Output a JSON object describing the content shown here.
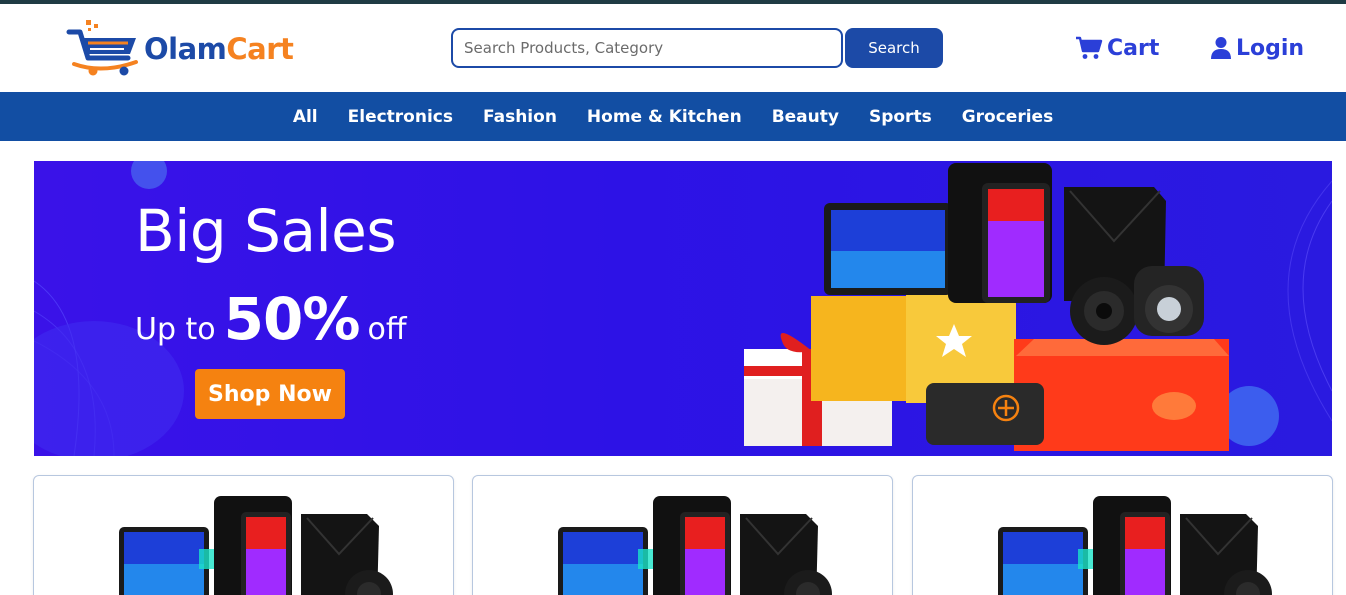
{
  "brand": {
    "name_part1": "Olam",
    "name_part2": "Cart",
    "logo_icon": "shopping-cart-icon",
    "colors": {
      "primary": "#1c4aa7",
      "accent": "#f58220"
    }
  },
  "search": {
    "placeholder": "Search Products, Category",
    "value": "",
    "button_label": "Search"
  },
  "header_links": {
    "cart": {
      "label": "Cart",
      "icon": "cart-icon"
    },
    "login": {
      "label": "Login",
      "icon": "user-icon"
    }
  },
  "nav": {
    "items": [
      {
        "label": "All"
      },
      {
        "label": "Electronics"
      },
      {
        "label": "Fashion"
      },
      {
        "label": "Home & Kitchen"
      },
      {
        "label": "Beauty"
      },
      {
        "label": "Sports"
      },
      {
        "label": "Groceries"
      }
    ],
    "background": "#124ea3"
  },
  "hero": {
    "title": "Big Sales",
    "subtitle_prefix": "Up to",
    "discount": "50%",
    "subtitle_suffix": "off",
    "button_label": "Shop Now",
    "colors": {
      "background": "#2d12e6",
      "button": "#f58210"
    }
  },
  "products": [
    {
      "image": "electronics-bundle-image"
    },
    {
      "image": "electronics-bundle-image"
    },
    {
      "image": "electronics-bundle-image"
    }
  ]
}
